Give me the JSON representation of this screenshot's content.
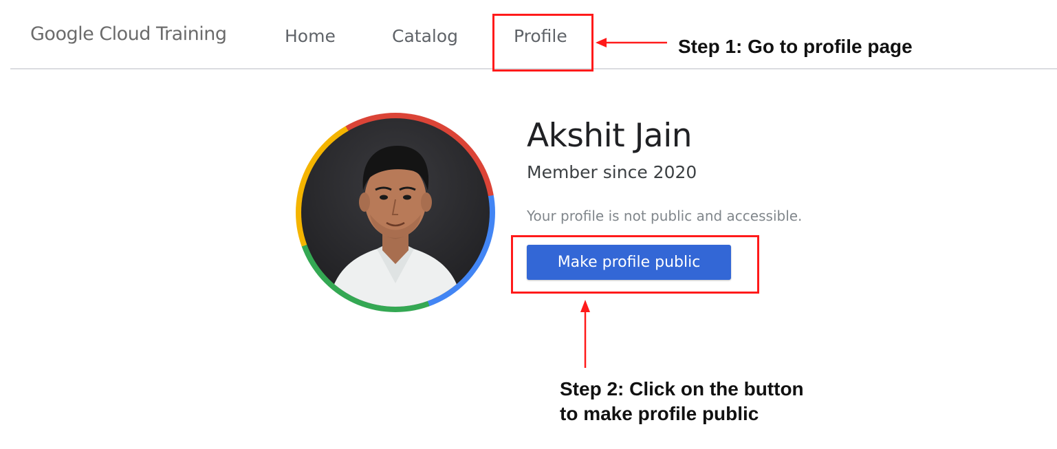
{
  "nav": {
    "brand": "Google Cloud Training",
    "items": [
      {
        "label": "Home"
      },
      {
        "label": "Catalog"
      },
      {
        "label": "Profile"
      }
    ]
  },
  "profile": {
    "name": "Akshit Jain",
    "member_since": "Member since 2020",
    "privacy_note": "Your profile is not public and accessible.",
    "make_public_label": "Make profile public",
    "ring_colors": [
      "#db4437",
      "#4285f4",
      "#34a853",
      "#f4b400"
    ]
  },
  "annotations": {
    "step1": "Step 1: Go to profile page",
    "step2_line1": "Step 2: Click on the button",
    "step2_line2": "to make profile public",
    "highlight_color": "#ff1a1a"
  },
  "colors": {
    "button_bg": "#3367d6",
    "text_primary": "#202124",
    "text_secondary": "#5f6368"
  }
}
